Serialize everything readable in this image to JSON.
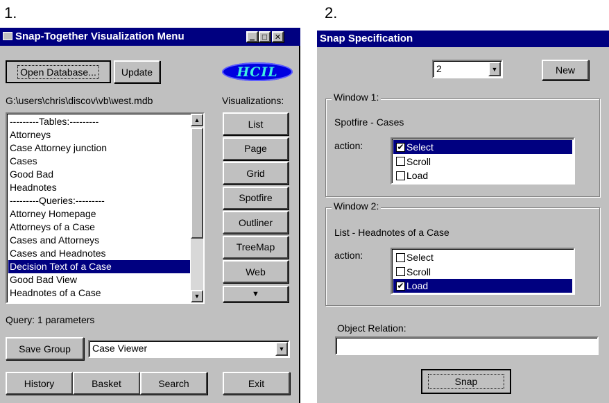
{
  "labels": {
    "left_number": "1.",
    "right_number": "2."
  },
  "menu_window": {
    "title": "Snap-Together Visualization Menu",
    "controls": {
      "minimize": "▁",
      "maximize": "□",
      "close": "✕"
    },
    "open_database": "Open Database...",
    "update": "Update",
    "logo": "HCIL",
    "db_path": "G:\\users\\chris\\discov\\vb\\west.mdb",
    "visualizations_label": "Visualizations:",
    "list_items": [
      "---------Tables:---------",
      "Attorneys",
      "Case Attorney junction",
      "Cases",
      "Good Bad",
      "Headnotes",
      "---------Queries:---------",
      "Attorney Homepage",
      "Attorneys of a Case",
      "Cases and Attorneys",
      "Cases and Headnotes",
      "Decision Text of a Case",
      "Good Bad View",
      "Headnotes of a Case"
    ],
    "selected_item": "Decision Text of a Case",
    "viz_buttons": [
      "List",
      "Page",
      "Grid",
      "Spotfire",
      "Outliner",
      "TreeMap",
      "Web"
    ],
    "more_arrow": "▼",
    "query_status": "Query:  1 parameters",
    "save_group": "Save Group",
    "group_select_value": "Case Viewer",
    "history": "History",
    "basket": "Basket",
    "search": "Search",
    "exit": "Exit"
  },
  "snap_window": {
    "title": "Snap Specification",
    "count_value": "2",
    "new_button": "New",
    "window1": {
      "label": "Window 1:",
      "source": "Spotfire - Cases",
      "action_label": "action:",
      "actions": [
        "Select",
        "Scroll",
        "Load"
      ]
    },
    "window2": {
      "label": "Window 2:",
      "source": "List - Headnotes of a Case",
      "action_label": "action:",
      "actions": [
        "Select",
        "Scroll",
        "Load"
      ]
    },
    "object_relation_label": "Object Relation:",
    "object_relation_value": "",
    "snap_button": "Snap"
  },
  "colors": {
    "titlebar": "#000080",
    "face": "#c0c0c0",
    "selection": "#000080"
  }
}
